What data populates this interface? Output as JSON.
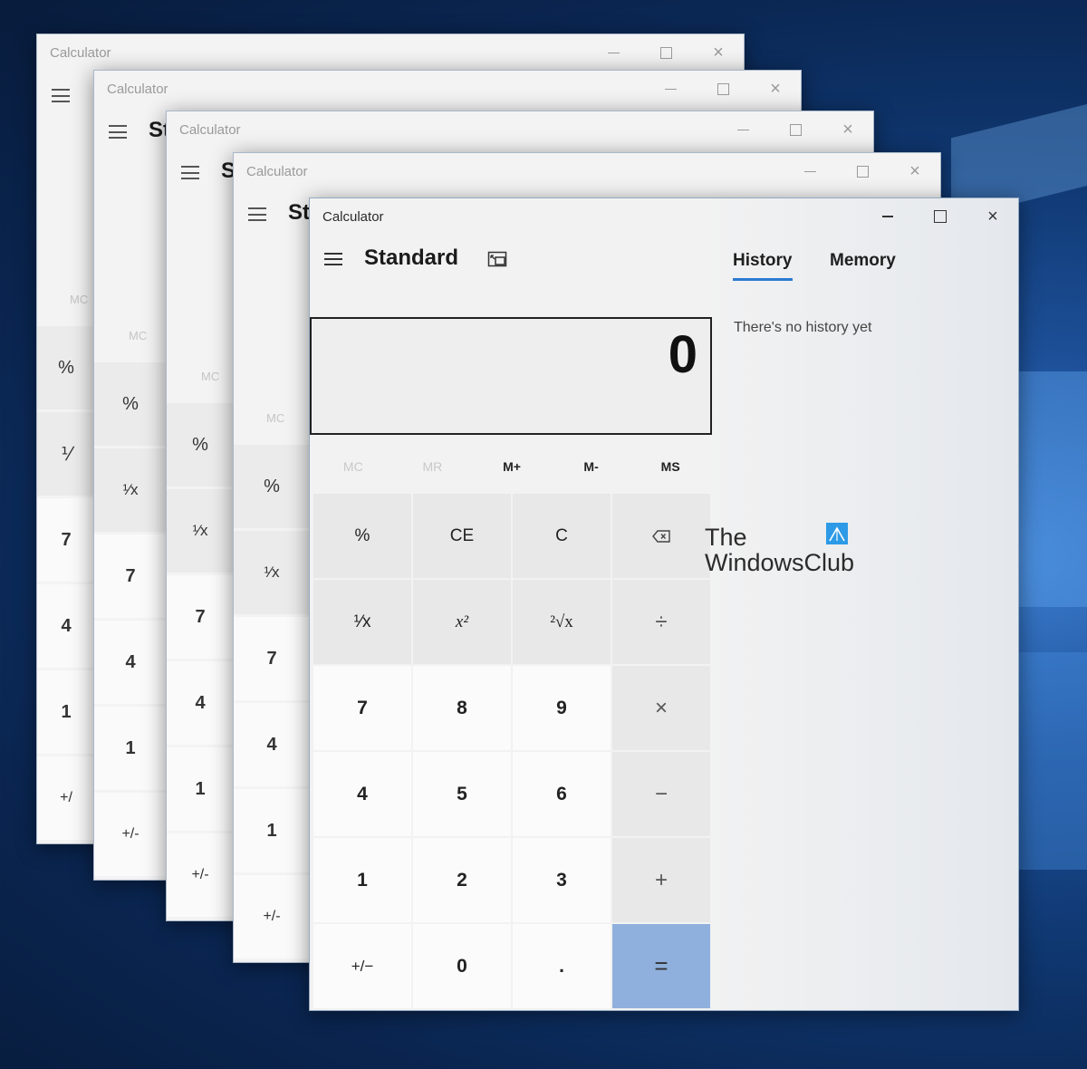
{
  "app_title": "Calculator",
  "mode": "Standard",
  "back_windows": {
    "mode_partial": [
      "St",
      "S",
      "St"
    ],
    "mem_label": "MC",
    "keys": [
      "%",
      "¹⁄x",
      "7",
      "4",
      "1",
      "+/-"
    ],
    "keys_clipped": [
      "%",
      "⅟",
      "7",
      "4",
      "1",
      "+/"
    ]
  },
  "tabs": {
    "history": "History",
    "memory": "Memory"
  },
  "history": {
    "empty_message": "There's no history yet"
  },
  "display": {
    "value": "0"
  },
  "memory_buttons": [
    {
      "label": "MC",
      "enabled": false
    },
    {
      "label": "MR",
      "enabled": false
    },
    {
      "label": "M+",
      "enabled": true
    },
    {
      "label": "M-",
      "enabled": true
    },
    {
      "label": "MS",
      "enabled": true
    }
  ],
  "keys": {
    "percent": "%",
    "clear_entry": "CE",
    "clear": "C",
    "backspace": "⌫",
    "reciprocal": "¹⁄x",
    "square": "x²",
    "sqrt": "²√x",
    "divide": "÷",
    "seven": "7",
    "eight": "8",
    "nine": "9",
    "multiply": "×",
    "four": "4",
    "five": "5",
    "six": "6",
    "minus": "−",
    "one": "1",
    "two": "2",
    "three": "3",
    "plus": "+",
    "negate": "+/−",
    "zero": "0",
    "decimal": ".",
    "equals": "="
  },
  "watermark": {
    "line1": "The",
    "line2": "WindowsClub"
  },
  "colors": {
    "accent": "#2a7ad2",
    "equals_bg": "#8fb0dc",
    "desktop": "#0f3770"
  }
}
